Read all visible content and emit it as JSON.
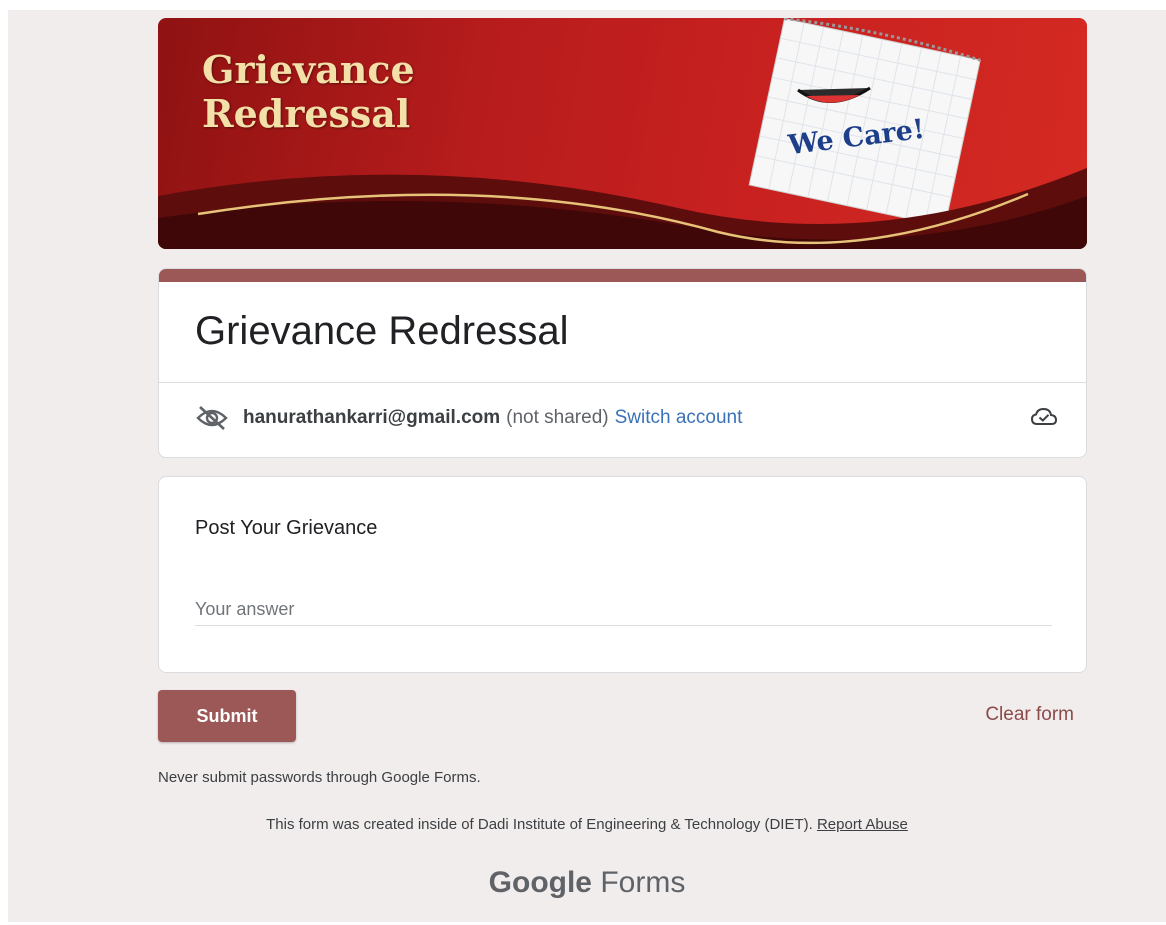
{
  "banner": {
    "title_line1": "Grievance",
    "title_line2": "Redressal",
    "tagline": "We Care!"
  },
  "form": {
    "title": "Grievance Redressal",
    "account": {
      "email": "hanurathankarri@gmail.com",
      "shared_note": "(not shared)",
      "switch_label": "Switch account"
    }
  },
  "question": {
    "label": "Post Your Grievance",
    "placeholder": "Your answer",
    "value": ""
  },
  "actions": {
    "submit_label": "Submit",
    "clear_label": "Clear form"
  },
  "footer": {
    "warning": "Never submit passwords through Google Forms.",
    "created_note": "This form was created inside of Dadi Institute of Engineering & Technology (DIET).",
    "report_label": "Report Abuse",
    "brand_google": "Google",
    "brand_forms": "Forms"
  },
  "colors": {
    "theme": "#9c5757",
    "background": "#f2eded",
    "link": "#3a72b8"
  },
  "icons": {
    "privacy": "eye-off-icon",
    "draft": "cloud-check-icon"
  }
}
